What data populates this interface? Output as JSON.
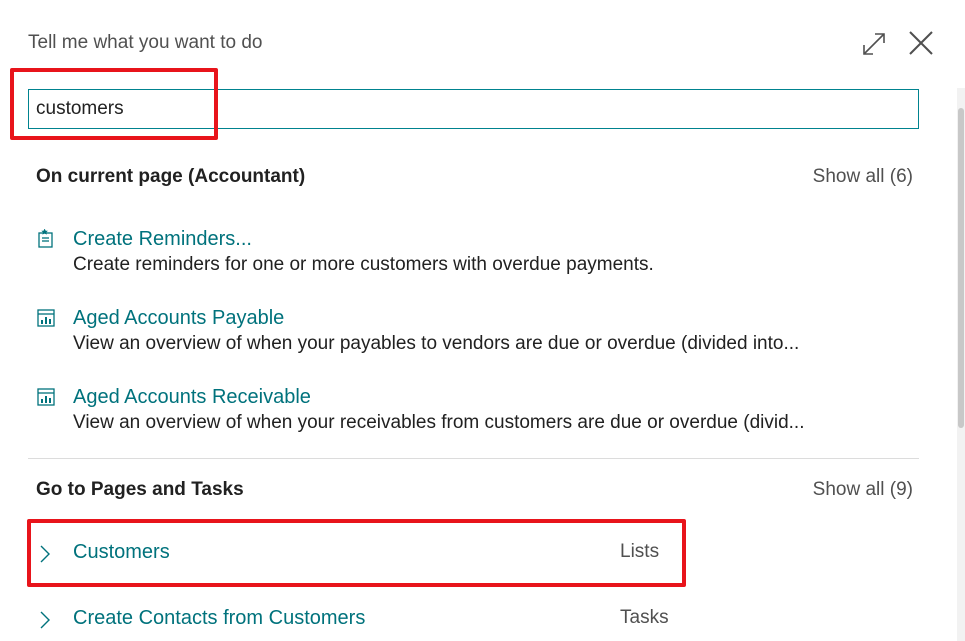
{
  "header": {
    "title": "Tell me what you want to do",
    "expand_icon": "expand-icon",
    "close_icon": "close-icon"
  },
  "search": {
    "value": "customers"
  },
  "current_page": {
    "heading": "On current page (Accountant)",
    "show_all": "Show all (6)",
    "results": [
      {
        "icon": "reminder-icon",
        "title": "Create Reminders...",
        "description": "Create reminders for one or more customers with overdue payments."
      },
      {
        "icon": "report-icon",
        "title": "Aged Accounts Payable",
        "description": "View an overview of when your payables to vendors are due or overdue (divided into..."
      },
      {
        "icon": "report-icon",
        "title": "Aged Accounts Receivable",
        "description": "View an overview of when your receivables from customers are due or overdue (divid..."
      }
    ]
  },
  "pages_tasks": {
    "heading": "Go to Pages and Tasks",
    "show_all": "Show all (9)",
    "items": [
      {
        "icon": "chevron-right-icon",
        "label": "Customers",
        "category": "Lists"
      },
      {
        "icon": "chevron-right-icon",
        "label": "Create Contacts from Customers",
        "category": "Tasks"
      }
    ]
  },
  "colors": {
    "accent": "#00727c",
    "input_border": "#00838f",
    "highlight": "#e8141b"
  }
}
